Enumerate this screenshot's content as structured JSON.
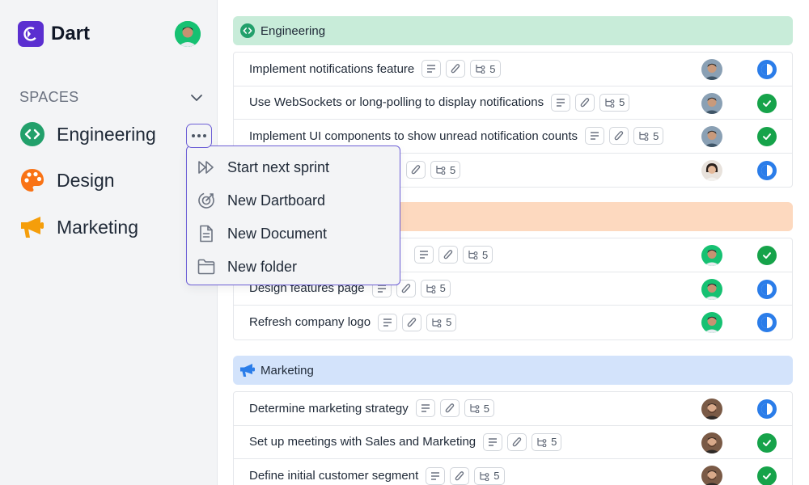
{
  "app": {
    "name": "Dart"
  },
  "sidebar": {
    "spaces_label": "SPACES",
    "spaces": [
      {
        "label": "Engineering",
        "icon": "code-icon",
        "color": "#22a06b"
      },
      {
        "label": "Design",
        "icon": "palette-icon",
        "color": "#f97316"
      },
      {
        "label": "Marketing",
        "icon": "megaphone-icon",
        "color": "#f59e0b"
      }
    ]
  },
  "menu": {
    "items": [
      {
        "label": "Start next sprint",
        "icon": "fast-forward-icon"
      },
      {
        "label": "New Dartboard",
        "icon": "dartboard-icon"
      },
      {
        "label": "New Document",
        "icon": "document-icon"
      },
      {
        "label": "New folder",
        "icon": "folder-icon"
      }
    ]
  },
  "groups": [
    {
      "name": "Engineering",
      "color": "#c8ecd9",
      "tasks": [
        {
          "title": "Implement notifications feature",
          "subtasks": "5",
          "status": "in-progress",
          "assignee": "male-dark"
        },
        {
          "title": "Use WebSockets or long-polling to display notifications",
          "subtasks": "5",
          "status": "done",
          "assignee": "male-dark"
        },
        {
          "title": "Implement UI components to show unread notification counts",
          "subtasks": "5",
          "status": "done",
          "assignee": "male-dark"
        },
        {
          "title": "",
          "subtasks": "5",
          "status": "in-progress",
          "assignee": "female"
        }
      ]
    },
    {
      "name": "",
      "color": "#fdd9bf",
      "tasks": [
        {
          "title": "",
          "subtasks": "5",
          "status": "done",
          "assignee": "male-green"
        },
        {
          "title": "Design features page",
          "subtasks": "5",
          "status": "in-progress",
          "assignee": "male-green"
        },
        {
          "title": "Refresh company logo",
          "subtasks": "5",
          "status": "in-progress",
          "assignee": "male-green"
        }
      ]
    },
    {
      "name": "Marketing",
      "color": "#d3e3fb",
      "tasks": [
        {
          "title": "Determine marketing strategy",
          "subtasks": "5",
          "status": "in-progress",
          "assignee": "male-beard"
        },
        {
          "title": "Set up meetings with Sales and Marketing",
          "subtasks": "5",
          "status": "done",
          "assignee": "male-beard"
        },
        {
          "title": "Define initial customer segment",
          "subtasks": "5",
          "status": "done",
          "assignee": "male-beard"
        }
      ]
    }
  ]
}
